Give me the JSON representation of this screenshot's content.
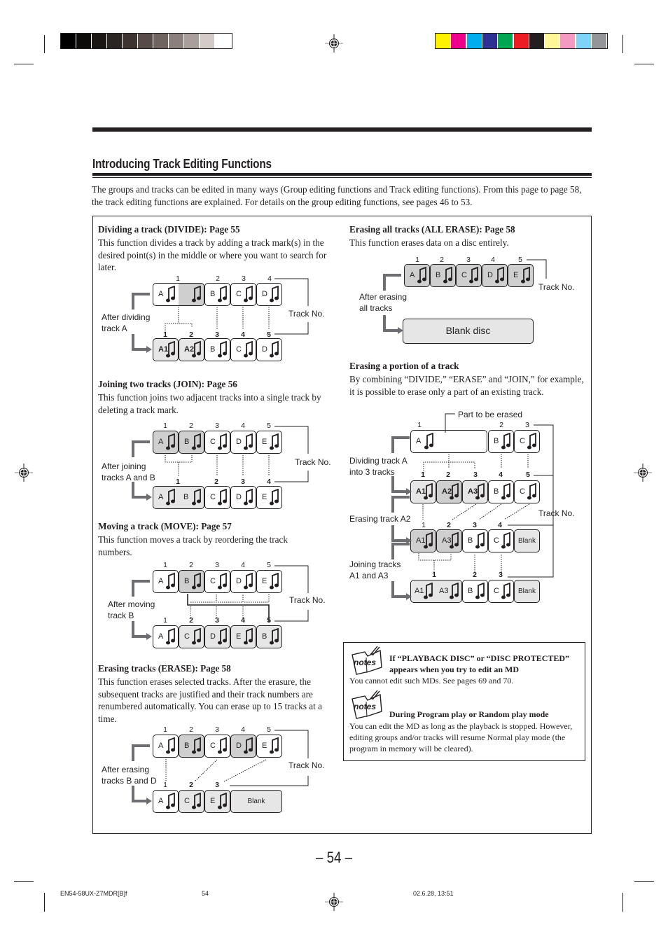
{
  "print_marks": {
    "grayscale_swatches": [
      "#000000",
      "#0d0b0a",
      "#1a1614",
      "#2a2523",
      "#3d3431",
      "#564b48",
      "#6f6460",
      "#8a7f7b",
      "#a89f9b",
      "#d3cbc8",
      "#ffffff"
    ],
    "color_swatches": [
      "#fff200",
      "#ec008c",
      "#00aeef",
      "#2e3192",
      "#00a651",
      "#ed1c24",
      "#231f20",
      "#fff799",
      "#f49ac2",
      "#7fd3f7",
      "#939598"
    ]
  },
  "page": {
    "title": "Introducing Track Editing Functions",
    "intro": "The groups and tracks can be edited in many ways (Group editing functions and Track editing functions). From this page to page 58, the track editing functions are explained. For details on the group editing functions, see pages 46 to 53.",
    "page_number": "– 54 –"
  },
  "track_no_label": "Track No.",
  "blank_label": "Blank",
  "sections": {
    "divide": {
      "heading": "Dividing a track (DIVIDE): Page 55",
      "body": "This function divides a track by adding a track mark(s) in the desired point(s) in the middle or where you want to search for later.",
      "caption": [
        "After dividing",
        "track A"
      ],
      "before_numbers": [
        "1",
        "2",
        "3",
        "4"
      ],
      "before_tracks": [
        "A",
        "",
        "B",
        "C",
        "D"
      ],
      "after_numbers": [
        "1",
        "2",
        "3",
        "4",
        "5"
      ],
      "after_tracks": [
        "A1",
        "A2",
        "B",
        "C",
        "D"
      ]
    },
    "join": {
      "heading": "Joining two tracks (JOIN): Page 56",
      "body": "This function joins two adjacent tracks into a single track by deleting a track mark.",
      "caption": [
        "After joining",
        "tracks A and B"
      ],
      "before_numbers": [
        "1",
        "2",
        "3",
        "4",
        "5"
      ],
      "before_tracks": [
        "A",
        "B",
        "C",
        "D",
        "E"
      ],
      "after_numbers": [
        "1",
        "2",
        "3",
        "4"
      ],
      "after_tracks": [
        "A",
        "B",
        "C",
        "D",
        "E"
      ]
    },
    "move": {
      "heading": "Moving a track (MOVE): Page 57",
      "body": "This function moves a track by reordering the track numbers.",
      "caption": [
        "After moving",
        "track B"
      ],
      "before_numbers": [
        "1",
        "2",
        "3",
        "4",
        "5"
      ],
      "before_tracks": [
        "A",
        "B",
        "C",
        "D",
        "E"
      ],
      "after_numbers": [
        "1",
        "2",
        "3",
        "4",
        "5"
      ],
      "after_tracks": [
        "A",
        "C",
        "D",
        "E",
        "B"
      ]
    },
    "erase": {
      "heading": "Erasing tracks (ERASE): Page 58",
      "body": "This function erases selected tracks. After the erasure, the subsequent tracks are justified and their track numbers are renumbered automatically. You can erase up to 15 tracks at a time.",
      "caption": [
        "After erasing",
        "tracks B and D"
      ],
      "before_numbers": [
        "1",
        "2",
        "3",
        "4",
        "5"
      ],
      "before_tracks": [
        "A",
        "B",
        "C",
        "D",
        "E"
      ],
      "after_numbers": [
        "1",
        "2",
        "3"
      ],
      "after_tracks": [
        "A",
        "C",
        "E"
      ]
    },
    "all_erase": {
      "heading": "Erasing all tracks (ALL ERASE): Page 58",
      "body": "This function erases data on a disc entirely.",
      "caption": [
        "After erasing",
        "all tracks"
      ],
      "before_numbers": [
        "1",
        "2",
        "3",
        "4",
        "5"
      ],
      "before_tracks": [
        "A",
        "B",
        "C",
        "D",
        "E"
      ],
      "blank_disc": "Blank disc"
    },
    "portion": {
      "heading": "Erasing a portion of a track",
      "body": "By combining “DIVIDE,” “ERASE” and “JOIN,” for example, it is possible to erase only a part of an existing track.",
      "part_label": "Part to be erased",
      "caption1": [
        "Dividing track A",
        "into 3 tracks"
      ],
      "caption2": "Erasing track A2",
      "caption3": [
        "Joining tracks",
        "A1 and A3"
      ],
      "row1_numbers": [
        "1",
        "2",
        "3"
      ],
      "row1_tracks": [
        "A",
        "B",
        "C"
      ],
      "row2_numbers": [
        "1",
        "2",
        "3",
        "4",
        "5"
      ],
      "row2_tracks": [
        "A1",
        "A2",
        "A3",
        "B",
        "C"
      ],
      "row3_numbers": [
        "1",
        "2",
        "3",
        "4"
      ],
      "row3_tracks": [
        "A1",
        "A3",
        "B",
        "C"
      ],
      "row4_numbers": [
        "1",
        "2",
        "3"
      ],
      "row4_tracks": [
        "A1",
        "A3",
        "B",
        "C"
      ]
    }
  },
  "notes": [
    {
      "icon": "notes-icon",
      "heading": [
        "If “PLAYBACK DISC” or “DISC PROTECTED”",
        "appears when you try to edit an MD"
      ],
      "body": "You cannot edit such MDs. See pages 69 and 70."
    },
    {
      "icon": "notes-icon",
      "heading": [
        "During Program play or Random play mode"
      ],
      "body": "You can edit the MD as long as the playback is stopped. However, editing groups and/or tracks will resume Normal play mode (the program in memory will be cleared)."
    }
  ],
  "footer": {
    "file": "EN54-58UX-Z7MDR[B]f",
    "page": "54",
    "timestamp": "02.6.28, 13:51"
  }
}
